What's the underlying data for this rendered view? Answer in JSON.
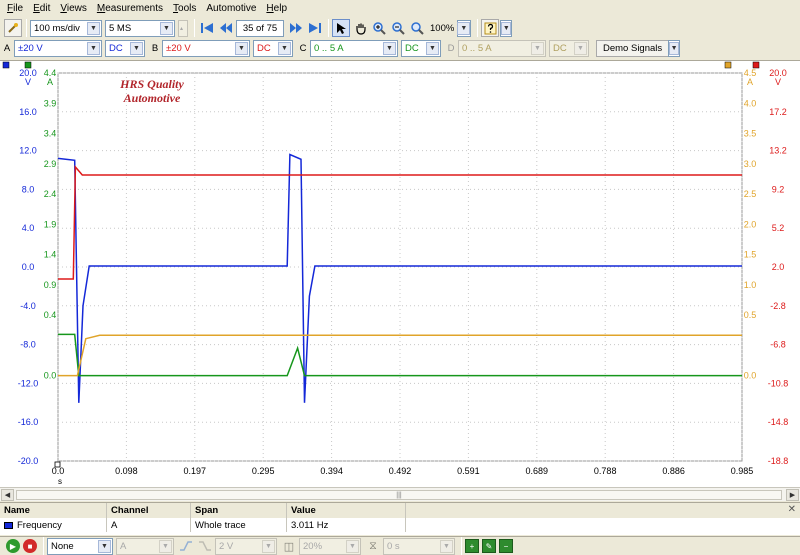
{
  "menu": {
    "items": [
      {
        "label": "File",
        "key": "F",
        "rest": "ile"
      },
      {
        "label": "Edit",
        "key": "E",
        "rest": "dit"
      },
      {
        "label": "Views",
        "key": "V",
        "rest": "iews"
      },
      {
        "label": "Measurements",
        "key": "M",
        "rest": "easurements"
      },
      {
        "label": "Tools",
        "key": "T",
        "rest": "ools"
      },
      {
        "label": "Automotive",
        "key": "",
        "rest": "Automotive"
      },
      {
        "label": "Help",
        "key": "H",
        "rest": "elp"
      }
    ]
  },
  "toolbar": {
    "timebase": "100 ms/div",
    "samples": "5 MS",
    "buffer_position": "35 of 75",
    "zoom": "100%"
  },
  "channels": [
    {
      "letter": "A",
      "range": "±20 V",
      "coupling": "DC",
      "color": "#1428d8",
      "enabled": true
    },
    {
      "letter": "B",
      "range": "±20 V",
      "coupling": "DC",
      "color": "#dd1a1a",
      "enabled": true
    },
    {
      "letter": "C",
      "range": "0 .. 5 A",
      "coupling": "DC",
      "color": "#16961c",
      "enabled": true
    },
    {
      "letter": "D",
      "range": "0 .. 5 A",
      "coupling": "DC",
      "color": "#e0a42a",
      "enabled": false
    }
  ],
  "demo_signals_label": "Demo Signals",
  "chart_data": {
    "type": "line",
    "logo_text": [
      "HRS Quality",
      "Automotive"
    ],
    "xlim": [
      0.0,
      0.985
    ],
    "x_ticks": [
      "0.0",
      "0.098",
      "0.197",
      "0.295",
      "0.394",
      "0.492",
      "0.591",
      "0.689",
      "0.788",
      "0.886",
      "0.985"
    ],
    "x_unit_label": "s",
    "grid": true,
    "axes": [
      {
        "channel": "A",
        "side": "left",
        "unit": "V",
        "color": "#1428d8",
        "ylim": [
          -20.0,
          20.0
        ],
        "ticks": [
          "20.0",
          "16.0",
          "12.0",
          "8.0",
          "4.0",
          "0.0",
          "-4.0",
          "-8.0",
          "-12.0",
          "-16.0",
          "-20.0"
        ]
      },
      {
        "channel": "C",
        "side": "left",
        "unit": "A",
        "color": "#16961c",
        "ylim": [
          0.0,
          4.4
        ],
        "ticks": [
          "4.4",
          "3.9",
          "3.4",
          "2.9",
          "2.4",
          "1.9",
          "1.4",
          "0.9",
          "0.4",
          "0.0"
        ]
      },
      {
        "channel": "D",
        "side": "right",
        "unit": "A",
        "color": "#e0a42a",
        "ylim": [
          0.0,
          4.5
        ],
        "ticks": [
          "4.5",
          "4.0",
          "3.5",
          "3.0",
          "2.5",
          "2.0",
          "1.5",
          "1.0",
          "0.5",
          "0.0"
        ]
      },
      {
        "channel": "B",
        "side": "right",
        "unit": "V",
        "color": "#dd1a1a",
        "ylim": [
          -18.8,
          20.0
        ],
        "ticks": [
          "20.0",
          "17.2",
          "13.2",
          "9.2",
          "5.2",
          "2.0",
          "-2.8",
          "-6.8",
          "-10.8",
          "-14.8",
          "-18.8"
        ]
      }
    ],
    "series": [
      {
        "name": "A",
        "color": "#1428d8",
        "points": [
          [
            0.0,
            11.2
          ],
          [
            0.024,
            11.0
          ],
          [
            0.03,
            -14.0
          ],
          [
            0.036,
            -4.0
          ],
          [
            0.045,
            0.1
          ],
          [
            0.33,
            0.1
          ],
          [
            0.334,
            11.6
          ],
          [
            0.35,
            11.1
          ],
          [
            0.355,
            -14.0
          ],
          [
            0.362,
            -3.0
          ],
          [
            0.37,
            0.1
          ],
          [
            0.985,
            0.1
          ]
        ]
      },
      {
        "name": "B",
        "color": "#dd1a1a",
        "points": [
          [
            0.0,
            -0.6
          ],
          [
            0.022,
            -0.6
          ],
          [
            0.025,
            10.6
          ],
          [
            0.035,
            9.8
          ],
          [
            0.985,
            9.8
          ]
        ]
      },
      {
        "name": "C",
        "color": "#16961c",
        "points": [
          [
            0.0,
            0.6
          ],
          [
            0.024,
            0.6
          ],
          [
            0.03,
            0.0
          ],
          [
            0.33,
            0.0
          ],
          [
            0.345,
            0.4
          ],
          [
            0.355,
            0.0
          ],
          [
            0.985,
            0.0
          ]
        ]
      },
      {
        "name": "D",
        "color": "#e0a42a",
        "points": [
          [
            0.0,
            0.0
          ],
          [
            0.028,
            0.0
          ],
          [
            0.04,
            0.55
          ],
          [
            0.06,
            0.6
          ],
          [
            0.985,
            0.6
          ]
        ]
      }
    ]
  },
  "measurements": {
    "headers": [
      "Name",
      "Channel",
      "Span",
      "Value"
    ],
    "rows": [
      {
        "name": "Frequency",
        "channel": "A",
        "span": "Whole trace",
        "value": "3.011 Hz"
      }
    ]
  },
  "statusbar": {
    "trigger_mode": "None",
    "trigger_channel": "A",
    "trigger_level": "2 V",
    "pretrigger": "20%",
    "delay": "0 s"
  }
}
